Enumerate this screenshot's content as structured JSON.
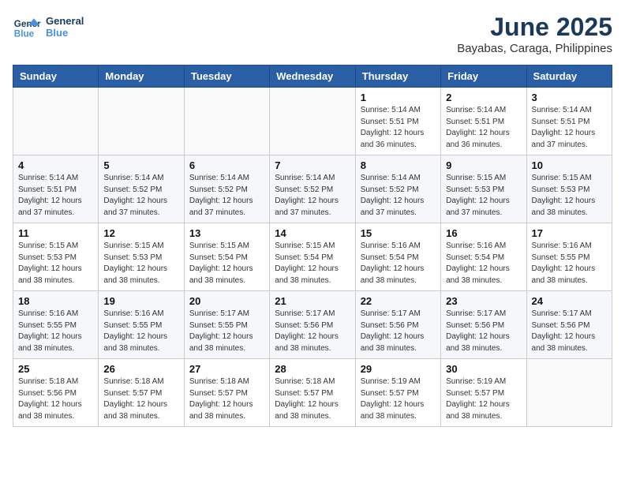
{
  "header": {
    "logo_line1": "General",
    "logo_line2": "Blue",
    "title": "June 2025",
    "subtitle": "Bayabas, Caraga, Philippines"
  },
  "calendar": {
    "weekdays": [
      "Sunday",
      "Monday",
      "Tuesday",
      "Wednesday",
      "Thursday",
      "Friday",
      "Saturday"
    ],
    "weeks": [
      [
        null,
        null,
        null,
        null,
        {
          "day": 1,
          "sunrise": "5:14 AM",
          "sunset": "5:51 PM",
          "daylight": "12 hours and 36 minutes."
        },
        {
          "day": 2,
          "sunrise": "5:14 AM",
          "sunset": "5:51 PM",
          "daylight": "12 hours and 36 minutes."
        },
        {
          "day": 3,
          "sunrise": "5:14 AM",
          "sunset": "5:51 PM",
          "daylight": "12 hours and 37 minutes."
        }
      ],
      [
        {
          "day": 4,
          "sunrise": "5:14 AM",
          "sunset": "5:51 PM",
          "daylight": "12 hours and 37 minutes."
        },
        {
          "day": 5,
          "sunrise": "5:14 AM",
          "sunset": "5:52 PM",
          "daylight": "12 hours and 37 minutes."
        },
        {
          "day": 6,
          "sunrise": "5:14 AM",
          "sunset": "5:52 PM",
          "daylight": "12 hours and 37 minutes."
        },
        {
          "day": 7,
          "sunrise": "5:14 AM",
          "sunset": "5:52 PM",
          "daylight": "12 hours and 37 minutes."
        },
        null,
        null,
        null
      ],
      [
        {
          "day": 8,
          "sunrise": "5:14 AM",
          "sunset": "5:52 PM",
          "daylight": "12 hours and 37 minutes."
        },
        {
          "day": 9,
          "sunrise": "5:15 AM",
          "sunset": "5:53 PM",
          "daylight": "12 hours and 37 minutes."
        },
        {
          "day": 10,
          "sunrise": "5:15 AM",
          "sunset": "5:53 PM",
          "daylight": "12 hours and 38 minutes."
        },
        {
          "day": 11,
          "sunrise": "5:15 AM",
          "sunset": "5:53 PM",
          "daylight": "12 hours and 38 minutes."
        },
        {
          "day": 12,
          "sunrise": "5:15 AM",
          "sunset": "5:53 PM",
          "daylight": "12 hours and 38 minutes."
        },
        {
          "day": 13,
          "sunrise": "5:15 AM",
          "sunset": "5:54 PM",
          "daylight": "12 hours and 38 minutes."
        },
        {
          "day": 14,
          "sunrise": "5:15 AM",
          "sunset": "5:54 PM",
          "daylight": "12 hours and 38 minutes."
        }
      ],
      [
        {
          "day": 15,
          "sunrise": "5:16 AM",
          "sunset": "5:54 PM",
          "daylight": "12 hours and 38 minutes."
        },
        {
          "day": 16,
          "sunrise": "5:16 AM",
          "sunset": "5:54 PM",
          "daylight": "12 hours and 38 minutes."
        },
        {
          "day": 17,
          "sunrise": "5:16 AM",
          "sunset": "5:55 PM",
          "daylight": "12 hours and 38 minutes."
        },
        {
          "day": 18,
          "sunrise": "5:16 AM",
          "sunset": "5:55 PM",
          "daylight": "12 hours and 38 minutes."
        },
        {
          "day": 19,
          "sunrise": "5:16 AM",
          "sunset": "5:55 PM",
          "daylight": "12 hours and 38 minutes."
        },
        {
          "day": 20,
          "sunrise": "5:17 AM",
          "sunset": "5:55 PM",
          "daylight": "12 hours and 38 minutes."
        },
        {
          "day": 21,
          "sunrise": "5:17 AM",
          "sunset": "5:56 PM",
          "daylight": "12 hours and 38 minutes."
        }
      ],
      [
        {
          "day": 22,
          "sunrise": "5:17 AM",
          "sunset": "5:56 PM",
          "daylight": "12 hours and 38 minutes."
        },
        {
          "day": 23,
          "sunrise": "5:17 AM",
          "sunset": "5:56 PM",
          "daylight": "12 hours and 38 minutes."
        },
        {
          "day": 24,
          "sunrise": "5:17 AM",
          "sunset": "5:56 PM",
          "daylight": "12 hours and 38 minutes."
        },
        {
          "day": 25,
          "sunrise": "5:18 AM",
          "sunset": "5:56 PM",
          "daylight": "12 hours and 38 minutes."
        },
        {
          "day": 26,
          "sunrise": "5:18 AM",
          "sunset": "5:57 PM",
          "daylight": "12 hours and 38 minutes."
        },
        {
          "day": 27,
          "sunrise": "5:18 AM",
          "sunset": "5:57 PM",
          "daylight": "12 hours and 38 minutes."
        },
        {
          "day": 28,
          "sunrise": "5:18 AM",
          "sunset": "5:57 PM",
          "daylight": "12 hours and 38 minutes."
        }
      ],
      [
        {
          "day": 29,
          "sunrise": "5:19 AM",
          "sunset": "5:57 PM",
          "daylight": "12 hours and 38 minutes."
        },
        {
          "day": 30,
          "sunrise": "5:19 AM",
          "sunset": "5:57 PM",
          "daylight": "12 hours and 38 minutes."
        },
        null,
        null,
        null,
        null,
        null
      ]
    ],
    "week_row_indices": [
      0,
      1,
      2,
      3,
      4,
      5
    ],
    "label_sunrise": "Sunrise:",
    "label_sunset": "Sunset:",
    "label_daylight": "Daylight:"
  }
}
